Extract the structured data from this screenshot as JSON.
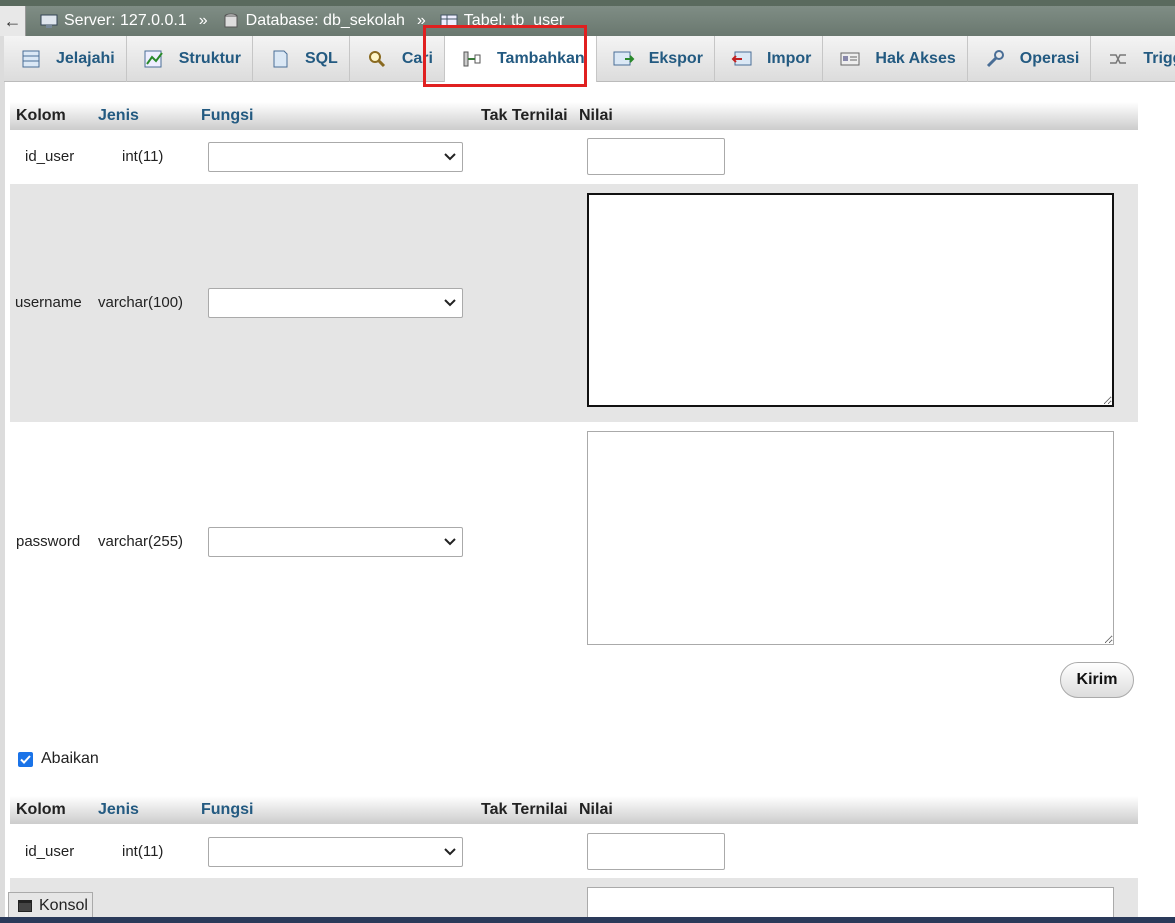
{
  "breadcrumb": {
    "back": "←",
    "server": "Server: 127.0.0.1",
    "database": "Database: db_sekolah",
    "table": "Tabel: tb_user",
    "sep": "»"
  },
  "tabs": [
    {
      "label": "Jelajahi",
      "icon": "browse-icon"
    },
    {
      "label": "Struktur",
      "icon": "structure-icon"
    },
    {
      "label": "SQL",
      "icon": "sql-icon"
    },
    {
      "label": "Cari",
      "icon": "search-icon"
    },
    {
      "label": "Tambahkan",
      "icon": "insert-icon",
      "active": true
    },
    {
      "label": "Ekspor",
      "icon": "export-icon"
    },
    {
      "label": "Impor",
      "icon": "import-icon"
    },
    {
      "label": "Hak Akses",
      "icon": "privileges-icon"
    },
    {
      "label": "Operasi",
      "icon": "operations-icon"
    },
    {
      "label": "Trigger",
      "icon": "trigger-icon"
    }
  ],
  "headers": {
    "kolom": "Kolom",
    "jenis": "Jenis",
    "fungsi": "Fungsi",
    "null": "Tak Ternilai",
    "nilai": "Nilai"
  },
  "rows": [
    {
      "column": "id_user",
      "type": "int(11)",
      "function": "",
      "value": ""
    },
    {
      "column": "username",
      "type": "varchar(100)",
      "function": "",
      "value": ""
    },
    {
      "column": "password",
      "type": "varchar(255)",
      "function": "",
      "value": ""
    }
  ],
  "submit_label": "Kirim",
  "ignore_label": "Abaikan",
  "ignore_checked": true,
  "second_rows": [
    {
      "column": "id_user",
      "type": "int(11)",
      "function": "",
      "value": ""
    }
  ],
  "console_label": "Konsol",
  "colors": {
    "link": "#235a81",
    "highlight": "#e02020",
    "checkbox": "#1a73e8"
  }
}
